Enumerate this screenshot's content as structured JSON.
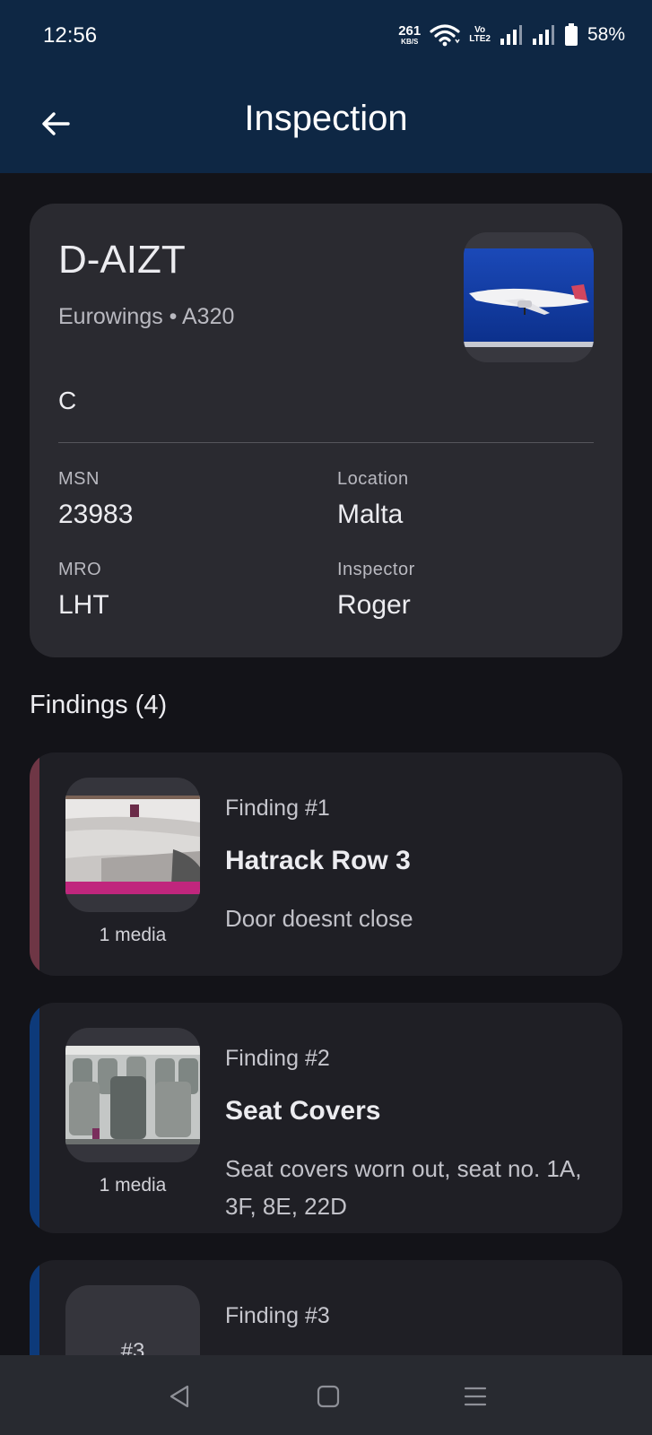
{
  "status_bar": {
    "time": "12:56",
    "net_speed": "261",
    "net_unit": "KB/S",
    "volte_top": "Vo",
    "volte_bottom": "LTE2",
    "battery": "58%"
  },
  "app_bar": {
    "title": "Inspection",
    "back_icon": "arrow-left-icon"
  },
  "aircraft": {
    "registration": "D-AIZT",
    "subtitle": "Eurowings • A320",
    "status": "C",
    "fields": {
      "msn_label": "MSN",
      "msn_value": "23983",
      "location_label": "Location",
      "location_value": "Malta",
      "mro_label": "MRO",
      "mro_value": "LHT",
      "inspector_label": "Inspector",
      "inspector_value": "Roger"
    }
  },
  "findings": {
    "header": "Findings (4)",
    "items": [
      {
        "number": "Finding #1",
        "title": "Hatrack Row 3",
        "description": "Door doesnt close",
        "media": "1 media",
        "accent": "#6e3645"
      },
      {
        "number": "Finding #2",
        "title": "Seat Covers",
        "description": "Seat covers worn out, seat no. 1A, 3F, 8E, 22D",
        "media": "1 media",
        "accent": "#0d3a7a"
      },
      {
        "number": "Finding #3",
        "thumb_label": "#3",
        "accent": "#0d3a7a"
      }
    ]
  },
  "nav_bar": {
    "back": "nav-back-icon",
    "home": "nav-home-icon",
    "recents": "nav-menu-icon"
  }
}
